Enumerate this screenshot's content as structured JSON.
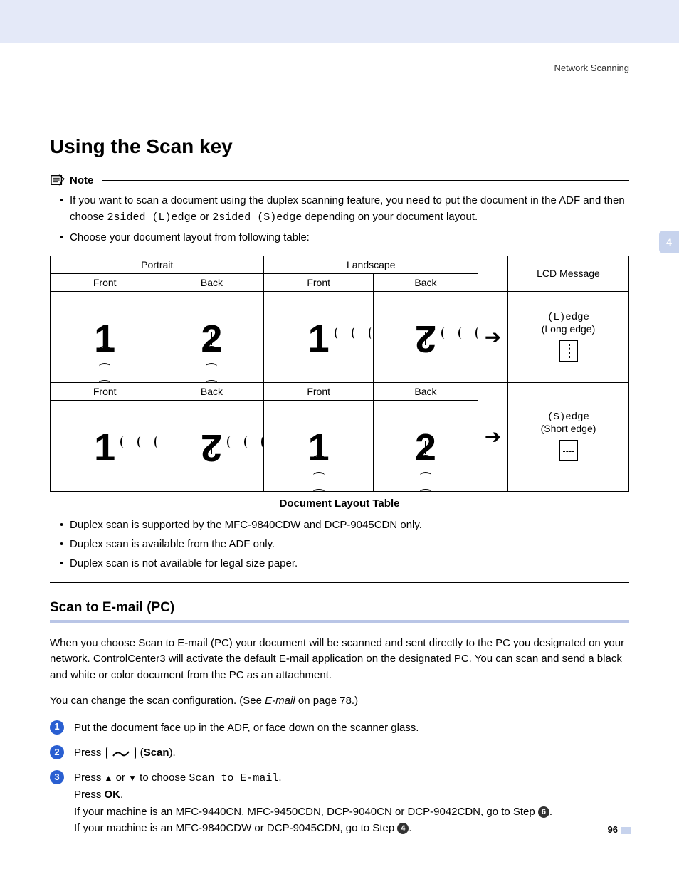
{
  "header": {
    "section": "Network Scanning",
    "chapter": "4"
  },
  "h1": "Using the Scan key",
  "note": {
    "title": "Note",
    "bullets_pre": [
      {
        "pre": "If you want to scan a document using the duplex scanning feature, you need to put the document in the ADF and then choose ",
        "mono1": "2sided (L)edge",
        "mid": " or ",
        "mono2": "2sided (S)edge",
        "post": " depending on your document layout."
      },
      {
        "pre": "Choose your document layout from following table:"
      }
    ],
    "bullets_post": [
      "Duplex scan is supported by the MFC-9840CDW and DCP-9045CDN only.",
      "Duplex scan is available from the ADF only.",
      "Duplex scan is not available for legal size paper."
    ]
  },
  "table": {
    "caption": "Document Layout Table",
    "headers": {
      "portrait": "Portrait",
      "landscape": "Landscape",
      "lcd": "LCD Message",
      "front": "Front",
      "back": "Back"
    },
    "lcd": [
      {
        "code": "(L)edge",
        "label": "(Long edge)"
      },
      {
        "code": "(S)edge",
        "label": "(Short edge)"
      }
    ]
  },
  "h2": "Scan to E-mail (PC)",
  "para1": "When you choose Scan to E-mail (PC) your document will be scanned and sent directly to the PC you designated on your network. ControlCenter3 will activate the default E-mail application on the designated PC. You can scan and send a black and white or color document from the PC as an attachment.",
  "para2": {
    "pre": "You can change the scan configuration. (See ",
    "link": "E-mail",
    "post": " on page 78.)"
  },
  "steps": {
    "s1": "Put the document face up in the ADF, or face down on the scanner glass.",
    "s2": {
      "pre": "Press ",
      "post": " (",
      "bold": "Scan",
      "end": ")."
    },
    "s3": {
      "l1_pre": "Press ",
      "l1_mid": " or ",
      "l1_post": " to choose ",
      "l1_mono": "Scan to E-mail",
      "l1_end": ".",
      "l2_pre": "Press ",
      "l2_bold": "OK",
      "l2_end": ".",
      "l3_pre": "If your machine is an MFC-9440CN, MFC-9450CDN, DCP-9040CN or DCP-9042CDN, go to Step ",
      "l3_num": "6",
      "l3_end": ".",
      "l4_pre": "If your machine is an MFC-9840CDW or DCP-9045CDN, go to Step ",
      "l4_num": "4",
      "l4_end": "."
    }
  },
  "page_number": "96"
}
